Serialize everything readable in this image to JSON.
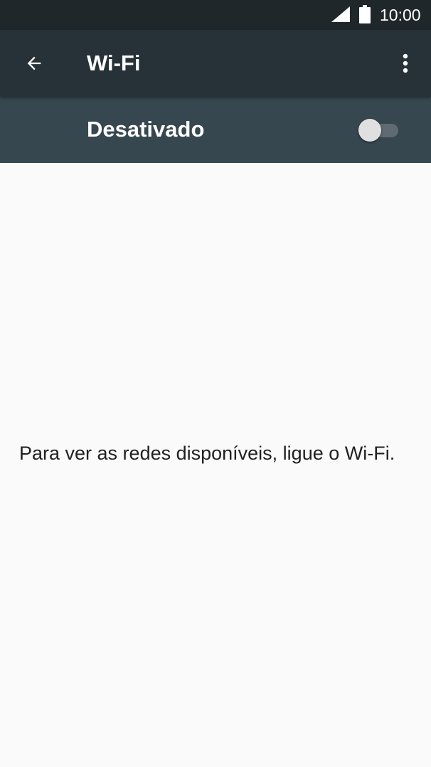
{
  "status_bar": {
    "time": "10:00",
    "signal_icon": "cell-signal-icon",
    "battery_icon": "battery-icon"
  },
  "app_bar": {
    "title": "Wi-Fi",
    "back_icon": "back-arrow-icon",
    "menu_icon": "more-vert-icon"
  },
  "wifi_switch": {
    "label": "Desativado",
    "state": "off"
  },
  "content": {
    "message": "Para ver as redes disponíveis, ligue o Wi-Fi."
  },
  "colors": {
    "status_bar": "#1f272b",
    "app_bar": "#263238",
    "switch_bar": "#37474f",
    "background": "#fafafa",
    "text_primary": "#212121",
    "on_dark": "#ffffff"
  }
}
